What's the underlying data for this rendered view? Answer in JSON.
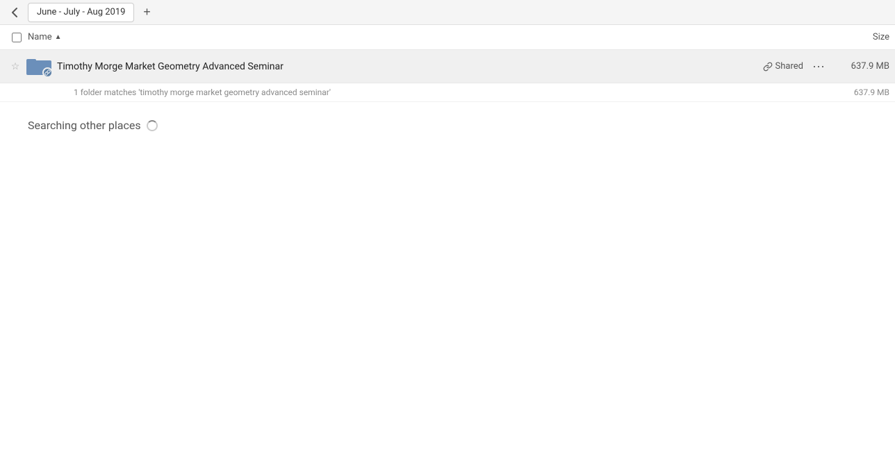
{
  "topbar": {
    "back_icon": "◀",
    "tab_label": "June - July - Aug 2019",
    "add_tab_icon": "+"
  },
  "columns": {
    "name_label": "Name",
    "sort_icon": "▲",
    "size_label": "Size"
  },
  "file_row": {
    "name": "Timothy Morge Market Geometry Advanced Seminar",
    "shared_label": "Shared",
    "more_icon": "•••",
    "size": "637.9 MB",
    "star_icon": "☆",
    "link_icon": "🔗"
  },
  "match_info": {
    "text": "1 folder matches 'timothy morge market geometry advanced seminar'",
    "size": "637.9 MB"
  },
  "searching": {
    "label": "Searching other places"
  }
}
